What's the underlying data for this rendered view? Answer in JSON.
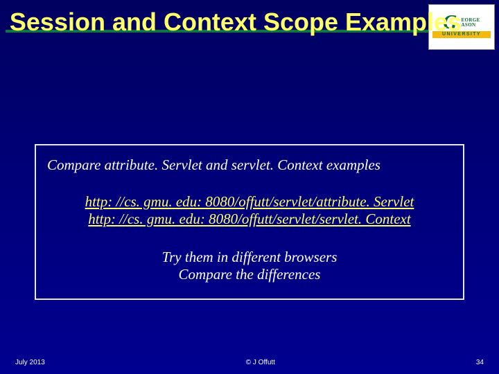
{
  "title": "Session and Context Scope Examples",
  "logo": {
    "top1": "G",
    "top2_line1": "EORGE",
    "top2_line2": "ASON",
    "bar": "UNIVERSITY"
  },
  "box": {
    "intro": "Compare attribute. Servlet and servlet. Context examples",
    "link1": "http: //cs. gmu. edu: 8080/offutt/servlet/attribute. Servlet",
    "link2": "http: //cs. gmu. edu: 8080/offutt/servlet/servlet. Context",
    "try1": "Try them in different browsers",
    "try2": "Compare the differences"
  },
  "footer": {
    "date": "July 2013",
    "copy": "© J Offutt",
    "page": "34"
  }
}
